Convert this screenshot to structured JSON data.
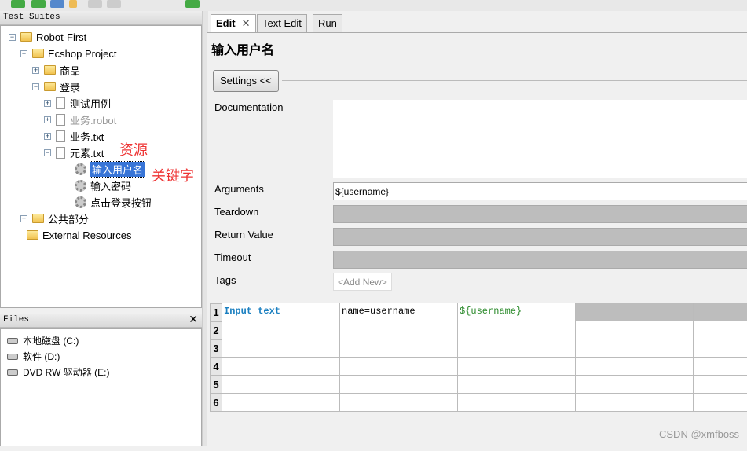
{
  "left": {
    "suites_title": "Test Suites",
    "files_title": "Files",
    "tree": [
      "Robot-First",
      "Ecshop Project",
      "商品",
      "登录",
      "测试用例",
      "业务.robot",
      "业务.txt",
      "元素.txt",
      "输入用户名",
      "输入密码",
      "点击登录按钮",
      "公共部分",
      "External Resources"
    ],
    "annotations": [
      "资源",
      "关键字"
    ],
    "files": [
      "本地磁盘 (C:)",
      "软件 (D:)",
      "DVD RW 驱动器 (E:)"
    ]
  },
  "tabs": [
    "Edit",
    "Text Edit",
    "Run"
  ],
  "editor": {
    "title": "输入用户名",
    "settings_button": "Settings <<",
    "labels": {
      "documentation": "Documentation",
      "arguments": "Arguments",
      "teardown": "Teardown",
      "return_value": "Return Value",
      "timeout": "Timeout",
      "tags": "Tags"
    },
    "arguments_value": "${username}",
    "add_new": "<Add New>"
  },
  "grid": {
    "row_numbers": [
      "1",
      "2",
      "3",
      "4",
      "5",
      "6"
    ],
    "row1": [
      "Input text",
      "name=username",
      "${username}"
    ]
  },
  "watermark": "CSDN @xmfboss"
}
